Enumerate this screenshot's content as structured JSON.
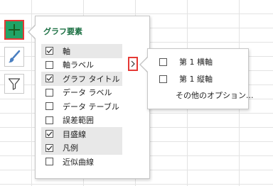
{
  "panel": {
    "title": "グラフ要素",
    "items": [
      {
        "label": "軸",
        "checked": true
      },
      {
        "label": "軸ラベル",
        "checked": false
      },
      {
        "label": "グラフ タイトル",
        "checked": true
      },
      {
        "label": "データ ラベル",
        "checked": false
      },
      {
        "label": "データ テーブル",
        "checked": false
      },
      {
        "label": "誤差範囲",
        "checked": false
      },
      {
        "label": "目盛線",
        "checked": true
      },
      {
        "label": "凡例",
        "checked": true
      },
      {
        "label": "近似曲線",
        "checked": false
      }
    ],
    "expand_glyph": "›"
  },
  "submenu": {
    "items": [
      {
        "label": "第 1 横軸",
        "checked": false
      },
      {
        "label": "第 1 縦軸",
        "checked": false
      }
    ],
    "more_options": "その他のオプション..."
  },
  "side_buttons": [
    {
      "icon": "plus-icon",
      "active": true
    },
    {
      "icon": "paintbrush-icon",
      "active": false
    },
    {
      "icon": "filter-icon",
      "active": false
    }
  ],
  "colors": {
    "accent_green": "#21a366",
    "title_green": "#1e7145",
    "highlight_red": "#e53935",
    "hover_gray": "#e8e8e8"
  }
}
